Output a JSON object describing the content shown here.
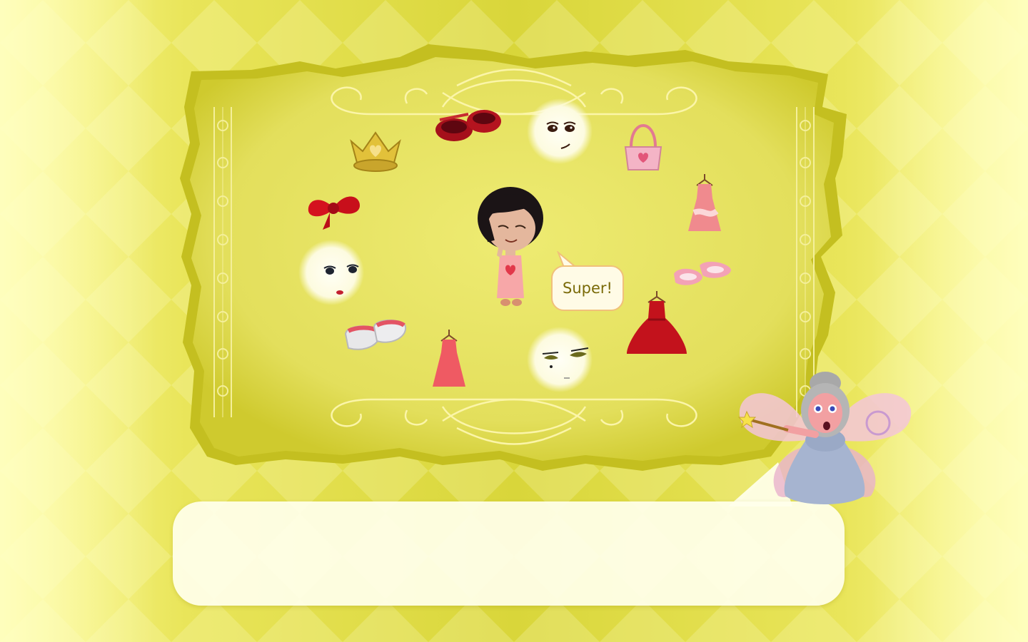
{
  "game": {
    "speech_bubble_text": "Super!",
    "dialog_text": ""
  },
  "colors": {
    "background": "#d9d63a",
    "board": "#e3df5c",
    "board_border": "#c7c223",
    "ornament": "#fbf5a8",
    "bubble_border": "#f1c07a",
    "bubble_text": "#7a6a08"
  },
  "items": [
    {
      "name": "crown",
      "icon": "crown-icon"
    },
    {
      "name": "red-shoes",
      "icon": "red-shoes-icon"
    },
    {
      "name": "face-happy",
      "icon": "face-icon"
    },
    {
      "name": "pink-handbag",
      "icon": "handbag-icon"
    },
    {
      "name": "red-bow",
      "icon": "bow-icon"
    },
    {
      "name": "pink-dress",
      "icon": "dress-icon"
    },
    {
      "name": "face-smile",
      "icon": "face-icon"
    },
    {
      "name": "pink-shoes",
      "icon": "shoes-icon"
    },
    {
      "name": "red-gown",
      "icon": "gown-icon"
    },
    {
      "name": "white-shoes",
      "icon": "shoes-icon"
    },
    {
      "name": "red-dress",
      "icon": "dress-icon"
    },
    {
      "name": "face-wink",
      "icon": "face-icon"
    }
  ],
  "characters": {
    "player": "doll-avatar",
    "guide": "fairy-godmother"
  }
}
